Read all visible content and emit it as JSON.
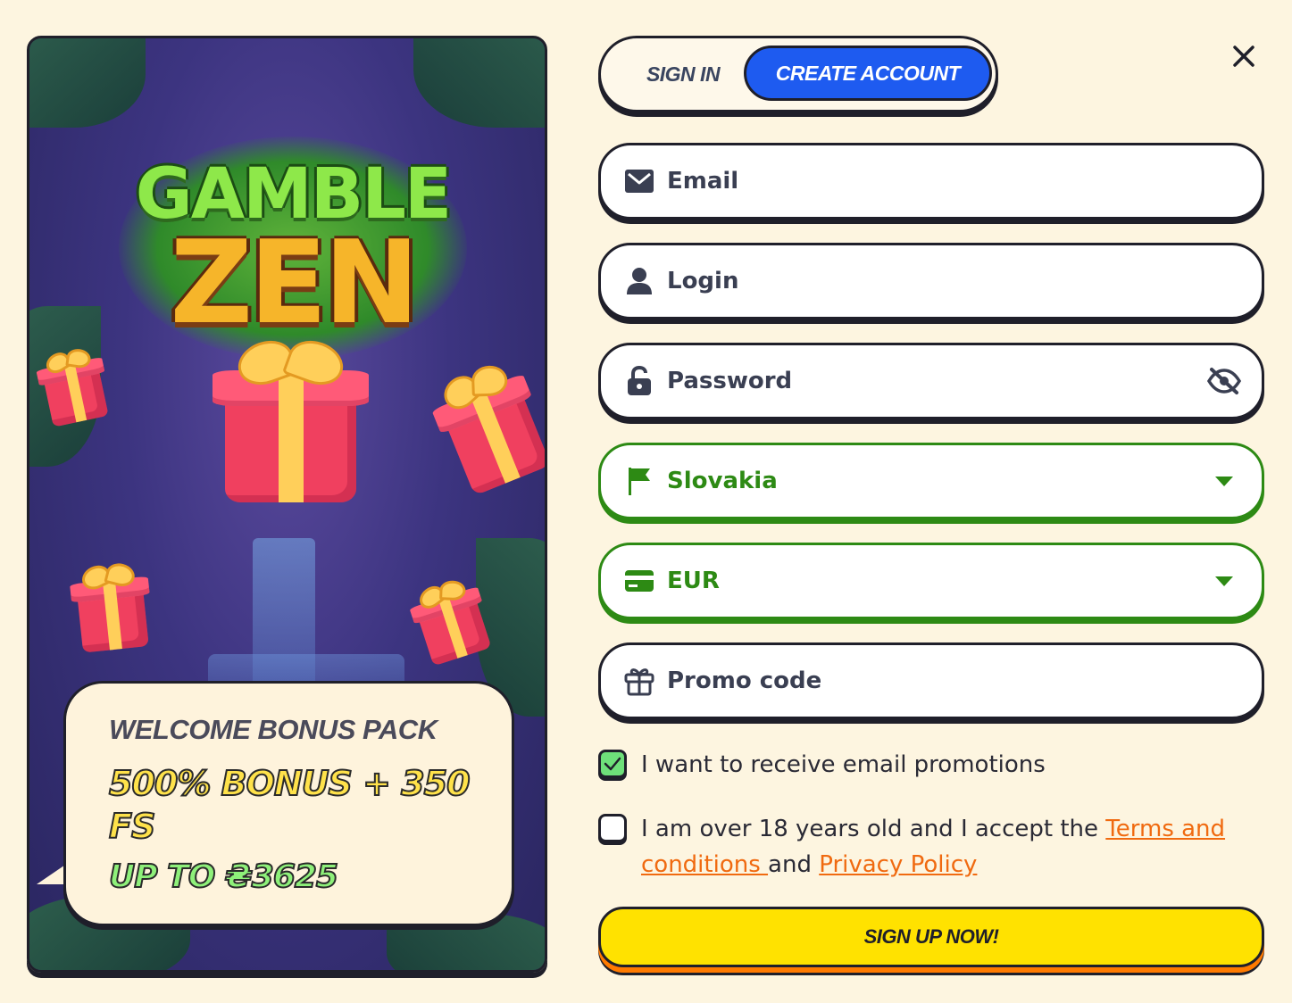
{
  "promo": {
    "logo_line1": "GAMBLE",
    "logo_line2": "ZEN",
    "bonus_title": "WELCOME BONUS PACK",
    "bonus_offer": "500% BONUS + 350 FS",
    "bonus_cap": "UP TO ₴3625"
  },
  "tabs": {
    "sign_in": "SIGN IN",
    "create_account": "CREATE ACCOUNT",
    "active": "create_account"
  },
  "form": {
    "email": {
      "placeholder": "Email",
      "icon": "envelope-icon"
    },
    "login": {
      "placeholder": "Login",
      "icon": "user-icon"
    },
    "password": {
      "placeholder": "Password",
      "icon": "lock-icon",
      "toggle_icon": "eye-slash-icon"
    },
    "country": {
      "value": "Slovakia",
      "icon": "flag-icon"
    },
    "currency": {
      "value": "EUR",
      "icon": "credit-card-icon"
    },
    "promo": {
      "placeholder": "Promo code",
      "icon": "gift-icon"
    }
  },
  "checkboxes": {
    "email_promotions": {
      "label": "I want to receive email promotions",
      "checked": true
    },
    "terms": {
      "prefix": "I am over 18 years old and I accept the ",
      "terms_link": "Terms and conditions ",
      "middle": "and ",
      "privacy_link": "Privacy Policy",
      "checked": false
    }
  },
  "submit_label": "SIGN UP NOW!",
  "colors": {
    "background": "#fdf5e0",
    "primary_blue": "#1e5bf0",
    "valid_green": "#2d8a14",
    "link_orange": "#f06a10",
    "cta_yellow": "#ffe200"
  }
}
